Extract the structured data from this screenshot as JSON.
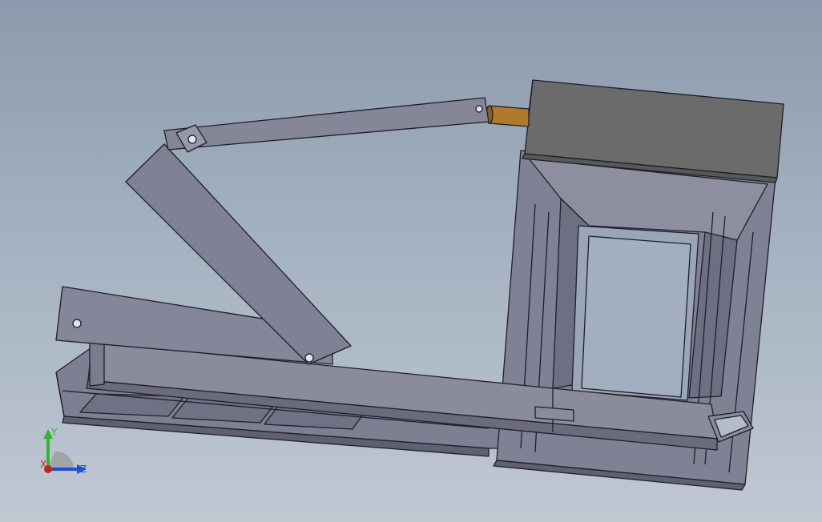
{
  "viewport": {
    "background_top": "#8b9bad",
    "background_bottom": "#c0c8d2"
  },
  "colors": {
    "part_light": "#8a8c9e",
    "part_mid": "#7a7c8f",
    "part_dark": "#5d5f70",
    "edge": "#1e1f26",
    "hopper_top": "#6b6b6b",
    "shaft": "#b07a2a"
  },
  "triad": {
    "y_label": "Y",
    "z_label": "Z",
    "x_label": "X",
    "y_color": "#2db82d",
    "z_color": "#1f4fd6",
    "x_color": "#c8201f"
  }
}
